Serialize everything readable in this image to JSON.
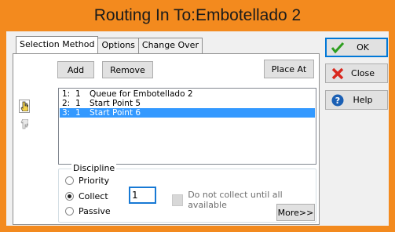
{
  "window": {
    "title": "Routing In To:Embotellado 2"
  },
  "tabs": [
    {
      "label": "Selection Method",
      "active": true
    },
    {
      "label": "Options",
      "active": false
    },
    {
      "label": "Change Over",
      "active": false
    }
  ],
  "toolbar": {
    "add_label": "Add",
    "remove_label": "Remove",
    "place_at_label": "Place At"
  },
  "routes": {
    "items": [
      {
        "index": "1:",
        "qty": "1",
        "name": "Queue for Embotellado 2",
        "selected": false
      },
      {
        "index": "2:",
        "qty": "1",
        "name": "Start Point 5",
        "selected": false
      },
      {
        "index": "3:",
        "qty": "1",
        "name": "Start Point 6",
        "selected": true
      }
    ]
  },
  "discipline": {
    "legend": "Discipline",
    "options": [
      {
        "label": "Priority",
        "selected": false
      },
      {
        "label": "Collect",
        "selected": true
      },
      {
        "label": "Passive",
        "selected": false
      }
    ],
    "collect_value": "1",
    "no_collect_label": "Do not collect until all available",
    "more_label": "More>>"
  },
  "actions": {
    "ok_label": "OK",
    "close_label": "Close",
    "help_label": "Help"
  },
  "colors": {
    "title_bar": "#f38a1e",
    "selection": "#3399ff",
    "ok_icon": "#2e9e1f",
    "close_icon": "#d9281e",
    "help_icon": "#1a5fb4"
  },
  "icons": [
    "hand-up-icon",
    "hand-down-icon",
    "checkmark-icon",
    "x-icon",
    "question-icon"
  ]
}
